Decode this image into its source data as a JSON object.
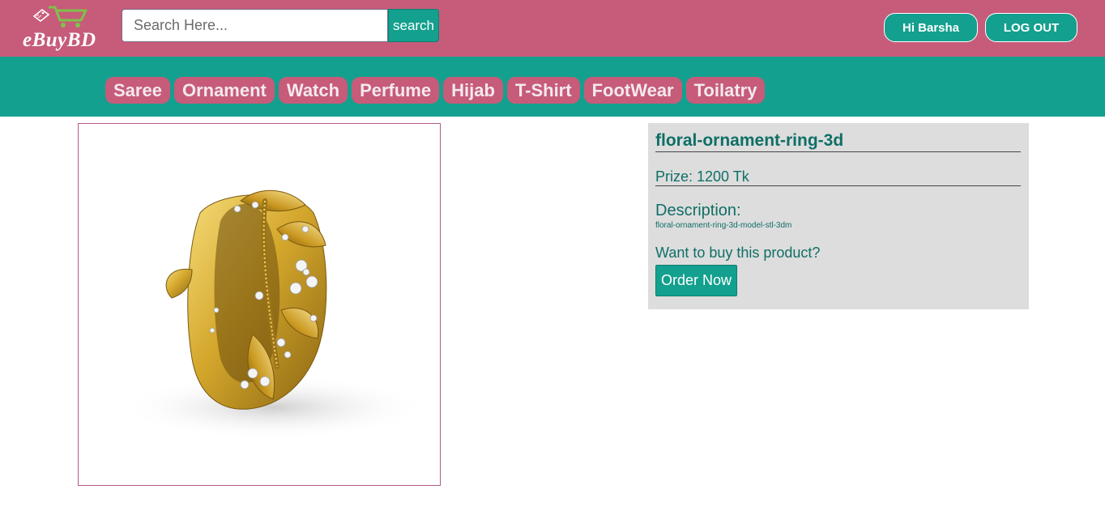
{
  "header": {
    "logo_text": "eBuyBD",
    "search": {
      "placeholder": "Search Here...",
      "value": "",
      "button_label": "search"
    },
    "greeting_label": "Hi Barsha",
    "logout_label": "LOG OUT"
  },
  "categories": [
    {
      "label": "Saree"
    },
    {
      "label": "Ornament"
    },
    {
      "label": "Watch"
    },
    {
      "label": "Perfume"
    },
    {
      "label": "Hijab"
    },
    {
      "label": "T-Shirt"
    },
    {
      "label": "FootWear"
    },
    {
      "label": "Toilatry"
    }
  ],
  "product": {
    "title": "floral-ornament-ring-3d",
    "price_text": "Prize: 1200 Tk",
    "description_label": "Description:",
    "description": "floral-ornament-ring-3d-model-stl-3dm",
    "cta_prompt": "Want to buy this product?",
    "order_label": "Order Now",
    "image": "gold-floral-ring-icon"
  },
  "colors": {
    "header_bg": "#c75b7a",
    "category_bar_bg": "#14a08e",
    "accent_teal": "#14a08e",
    "text_teal": "#0f6f66",
    "info_panel_bg": "#dddddd",
    "ring_gold": "#d4a72c"
  }
}
